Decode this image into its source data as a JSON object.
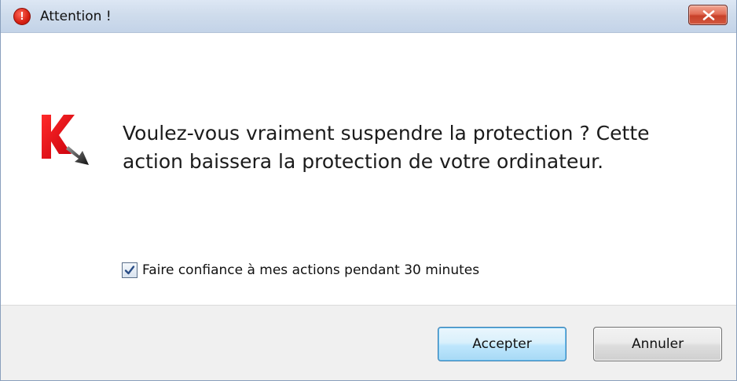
{
  "window": {
    "title": "Attention !",
    "title_icon": "exclamation-icon",
    "title_icon_glyph": "!",
    "close_icon": "close-icon"
  },
  "content": {
    "app_icon": "kaspersky-logo",
    "message": "Voulez-vous vraiment suspendre la protection ? Cette action baissera la protection de votre ordinateur.",
    "trust_checkbox": {
      "label": "Faire confiance à mes actions pendant 30 minutes",
      "checked": true
    }
  },
  "footer": {
    "accept_label": "Accepter",
    "cancel_label": "Annuler"
  },
  "colors": {
    "title_icon": "#d61f12",
    "close_button": "#c8412a",
    "logo_red": "#e3000f",
    "accept_border": "#3c7fb1"
  }
}
